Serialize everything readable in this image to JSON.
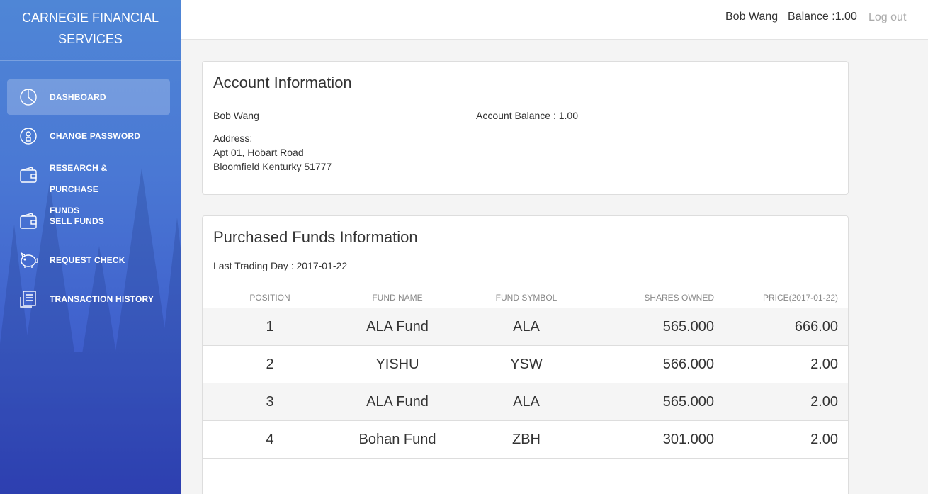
{
  "brand": {
    "line1": "CARNEGIE FINANCIAL",
    "line2": "SERVICES"
  },
  "nav": [
    {
      "label": "DASHBOARD",
      "icon": "pie-chart-icon",
      "active": true
    },
    {
      "label": "CHANGE PASSWORD",
      "icon": "lock-icon"
    },
    {
      "label_line1": "RESEARCH & PURCHASE",
      "label_line2": "FUNDS",
      "icon": "wallet-icon"
    },
    {
      "label": "SELL FUNDS",
      "icon": "wallet-icon"
    },
    {
      "label": "REQUEST CHECK",
      "icon": "piggy-bank-icon"
    },
    {
      "label": "TRANSACTION HISTORY",
      "icon": "receipt-icon"
    }
  ],
  "topbar": {
    "user": "Bob Wang",
    "balance": "Balance :1.00",
    "logout": "Log out"
  },
  "account": {
    "title": "Account Information",
    "name": "Bob Wang",
    "balance": "Account Balance : 1.00",
    "address_label": "Address:",
    "address_line1": "Apt 01, Hobart Road",
    "address_line2": "Bloomfield Kenturky 51777"
  },
  "funds": {
    "title": "Purchased Funds Information",
    "last_trading_day": "Last Trading Day : 2017-01-22",
    "columns": [
      "POSITION",
      "FUND NAME",
      "FUND SYMBOL",
      "SHARES OWNED",
      "PRICE(2017-01-22)"
    ],
    "rows": [
      {
        "position": "1",
        "name": "ALA Fund",
        "symbol": "ALA",
        "shares": "565.000",
        "price": "666.00"
      },
      {
        "position": "2",
        "name": "YISHU",
        "symbol": "YSW",
        "shares": "566.000",
        "price": "2.00"
      },
      {
        "position": "3",
        "name": "ALA Fund",
        "symbol": "ALA",
        "shares": "565.000",
        "price": "2.00"
      },
      {
        "position": "4",
        "name": "Bohan Fund",
        "symbol": "ZBH",
        "shares": "301.000",
        "price": "2.00"
      }
    ]
  },
  "colors": {
    "sidebar_top": "#4f86d6",
    "sidebar_bottom": "#3344c0",
    "page_bg": "#f4f4f4"
  }
}
